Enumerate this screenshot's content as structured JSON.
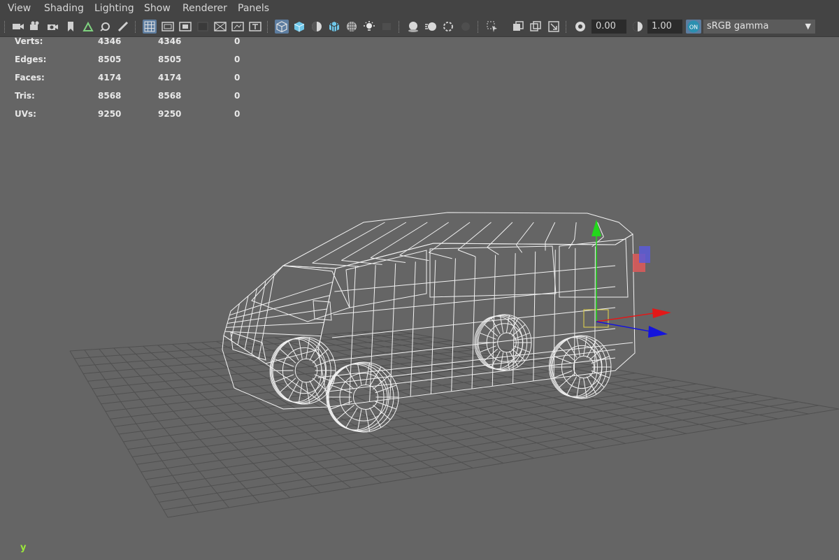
{
  "menu": [
    "View",
    "Shading",
    "Lighting",
    "Show",
    "Renderer",
    "Panels"
  ],
  "toolbar": {
    "exposure_value": "0.00",
    "gamma_value": "1.00",
    "colorspace_badge": "ON",
    "colorspace_label": "sRGB gamma"
  },
  "hud": {
    "rows": [
      {
        "label": "Verts:",
        "v1": "4346",
        "v2": "4346",
        "v3": "0"
      },
      {
        "label": "Edges:",
        "v1": "8505",
        "v2": "8505",
        "v3": "0"
      },
      {
        "label": "Faces:",
        "v1": "4174",
        "v2": "4174",
        "v3": "0"
      },
      {
        "label": "Tris:",
        "v1": "8568",
        "v2": "8568",
        "v3": "0"
      },
      {
        "label": "UVs:",
        "v1": "9250",
        "v2": "9250",
        "v3": "0"
      }
    ]
  },
  "axis_indicator": {
    "label": "y"
  },
  "colors": {
    "accent": "#5d7da0",
    "viewport_bg": "#656565",
    "panel_bg": "#444444",
    "gizmo_x": "#e21818",
    "gizmo_y": "#22d81c",
    "gizmo_z": "#1414dc"
  }
}
